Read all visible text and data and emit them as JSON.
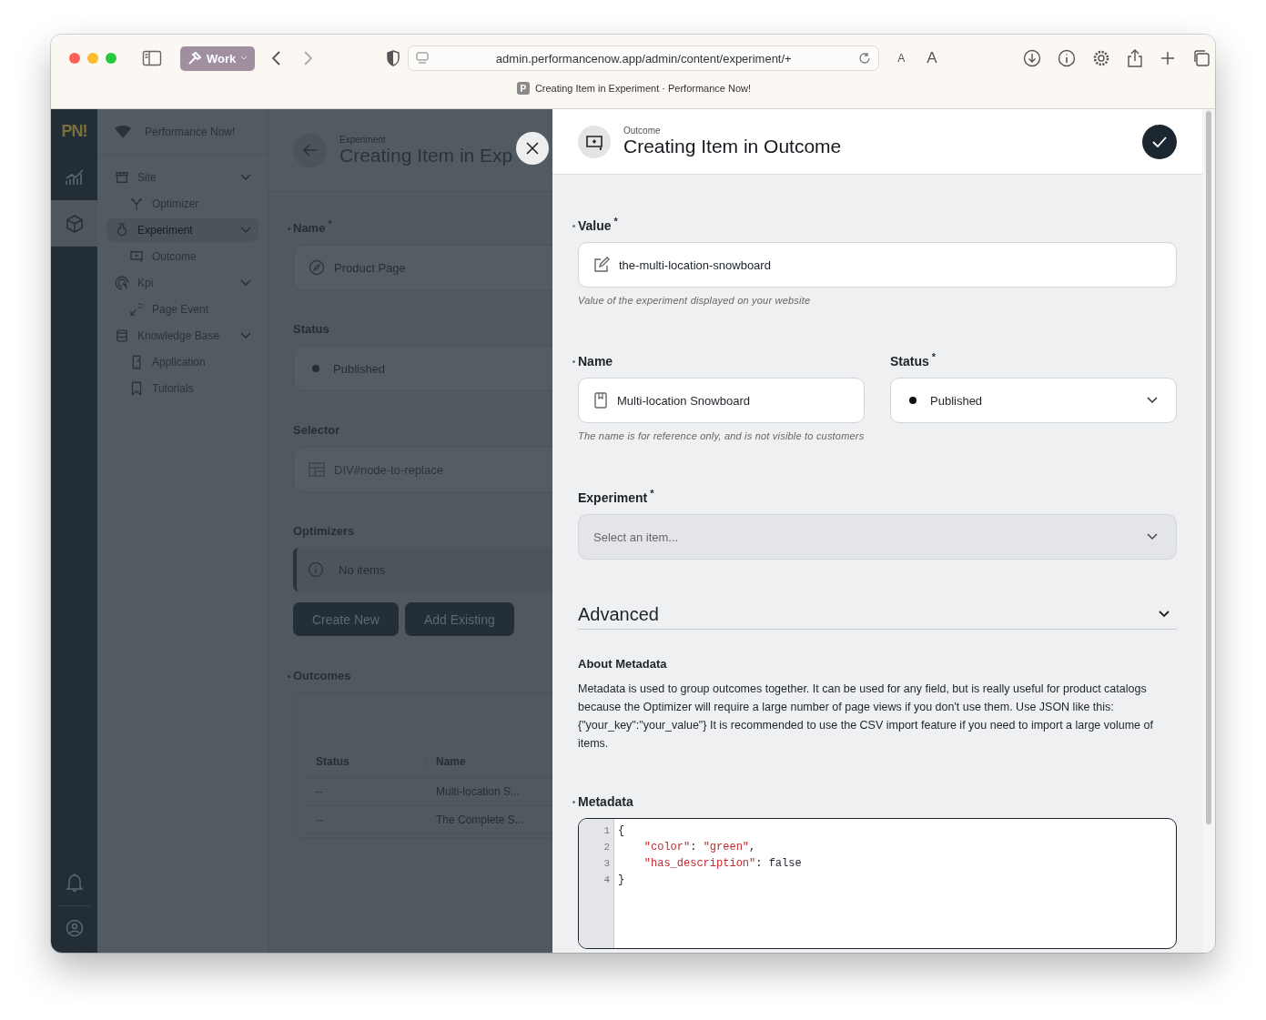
{
  "browser": {
    "tab_group": "Work",
    "url": "admin.performancenow.app/admin/content/experiment/+",
    "small_a": "A",
    "large_a": "A",
    "favicon_letter": "P",
    "page_title": "Creating Item in Experiment · Performance Now!"
  },
  "rail": {
    "logo": "PN!",
    "items": [
      {
        "kind": "chart",
        "selected": false
      },
      {
        "kind": "cube",
        "selected": true
      }
    ]
  },
  "sidebar": {
    "brand": "Performance Now!",
    "items": [
      {
        "label": "Site",
        "kind": "store",
        "selected": false,
        "expanded": true,
        "children": [
          {
            "label": "Optimizer",
            "kind": "branch"
          }
        ]
      },
      {
        "label": "Experiment",
        "kind": "flask",
        "selected": true,
        "expanded": true,
        "children": [
          {
            "label": "Outcome",
            "kind": "outcome"
          }
        ]
      },
      {
        "label": "Kpi",
        "kind": "target",
        "selected": false,
        "expanded": true,
        "children": [
          {
            "label": "Page Event",
            "kind": "event"
          }
        ]
      },
      {
        "label": "Knowledge Base",
        "kind": "database",
        "selected": false,
        "expanded": true,
        "children": [
          {
            "label": "Application",
            "kind": "application"
          },
          {
            "label": "Tutorials",
            "kind": "bookmark"
          }
        ]
      }
    ]
  },
  "background_form": {
    "overline": "Experiment",
    "title": "Creating Item in Exp",
    "fields": [
      {
        "label": "Name",
        "asterisk": "*",
        "marked": true,
        "kind": "text",
        "value": "Product Page"
      },
      {
        "label": "Status",
        "marked": false,
        "kind": "status",
        "value": "Published"
      },
      {
        "label": "Selector",
        "marked": false,
        "kind": "selector",
        "value": "DIV#node-to-replace"
      }
    ],
    "optimizers": {
      "label": "Optimizers",
      "notice": "No items",
      "buttons": [
        "Create New",
        "Add Existing"
      ]
    },
    "outcomes": {
      "label": "Outcomes",
      "marked": true,
      "columns": [
        "Status",
        "Name"
      ],
      "rows": [
        {
          "status": "--",
          "name": "Multi-location S..."
        },
        {
          "status": "--",
          "name": "The Complete S..."
        }
      ]
    }
  },
  "drawer": {
    "overline": "Outcome",
    "title": "Creating Item in Outcome",
    "value": {
      "label": "Value",
      "asterisk": "*",
      "marked": true,
      "value": "the-multi-location-snowboard",
      "hint": "Value of the experiment displayed on your website"
    },
    "name": {
      "label": "Name",
      "marked": true,
      "value": "Multi-location Snowboard",
      "hint": "The name is for reference only, and is not visible to customers"
    },
    "status": {
      "label": "Status",
      "asterisk": "*",
      "marked": false,
      "value": "Published"
    },
    "experiment": {
      "label": "Experiment",
      "asterisk": "*",
      "marked": false,
      "placeholder": "Select an item..."
    },
    "advanced": {
      "title": "Advanced",
      "expanded": true,
      "heading": "About Metadata",
      "text": "Metadata is used to group outcomes together. It can be used for any field, but is really useful for product catalogs because the Optimizer will require a large number of page views if you don't use them. Use JSON like this: {\"your_key\":\"your_value\"} It is recommended to use the CSV import feature if you need to import a large volume of items."
    },
    "metadata": {
      "label": "Metadata",
      "marked": true,
      "lines": [
        {
          "number": "1",
          "code": "{"
        },
        {
          "number": "2",
          "code": "    \"color\": \"green\","
        },
        {
          "number": "3",
          "code": "    \"has_description\": false"
        },
        {
          "number": "4",
          "code": "}"
        }
      ]
    }
  }
}
